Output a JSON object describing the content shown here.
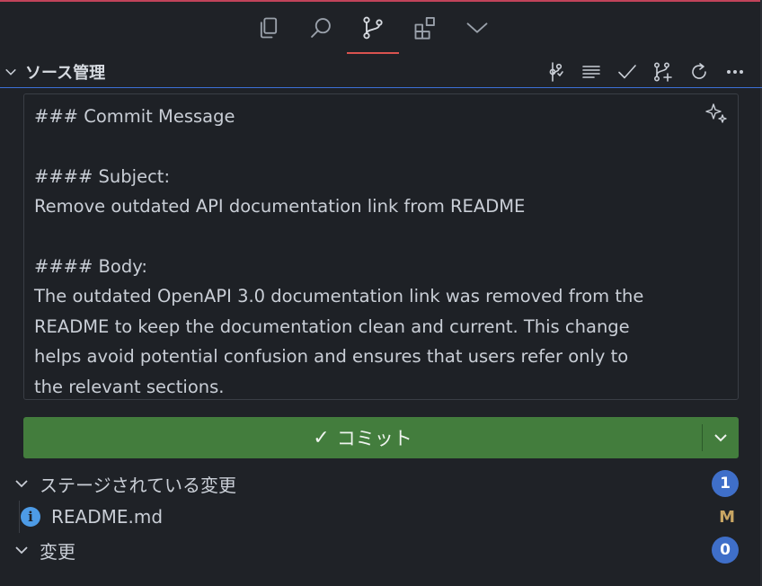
{
  "activity_bar": {
    "tabs": [
      {
        "icon": "explorer-icon"
      },
      {
        "icon": "search-icon"
      },
      {
        "icon": "source-control-icon",
        "active": true
      },
      {
        "icon": "extensions-icon"
      },
      {
        "icon": "chevron-down-icon"
      }
    ]
  },
  "section": {
    "title": "ソース管理",
    "toolbar": [
      "graph-icon",
      "list-icon",
      "check-icon",
      "pull-request-icon",
      "refresh-icon",
      "more-icon"
    ]
  },
  "commit_message": {
    "lines": [
      "### Commit Message",
      "",
      "#### Subject:",
      "Remove outdated API documentation link from README",
      "",
      "#### Body:",
      "The outdated OpenAPI 3.0 documentation link was removed from the",
      "README to keep the documentation clean and current. This change",
      "helps avoid potential confusion and ensures that users refer only to",
      "the relevant sections."
    ]
  },
  "commit_button": {
    "label": "コミット",
    "check": "✓"
  },
  "staged": {
    "label": "ステージされている変更",
    "count": "1",
    "files": [
      {
        "name": "README.md",
        "status": "M"
      }
    ]
  },
  "changes": {
    "label": "変更",
    "count": "0"
  },
  "colors": {
    "accent": "#3c6fd6",
    "commit_green": "#437d3d",
    "badge": "#3f6fc9",
    "modified": "#c9a663"
  }
}
